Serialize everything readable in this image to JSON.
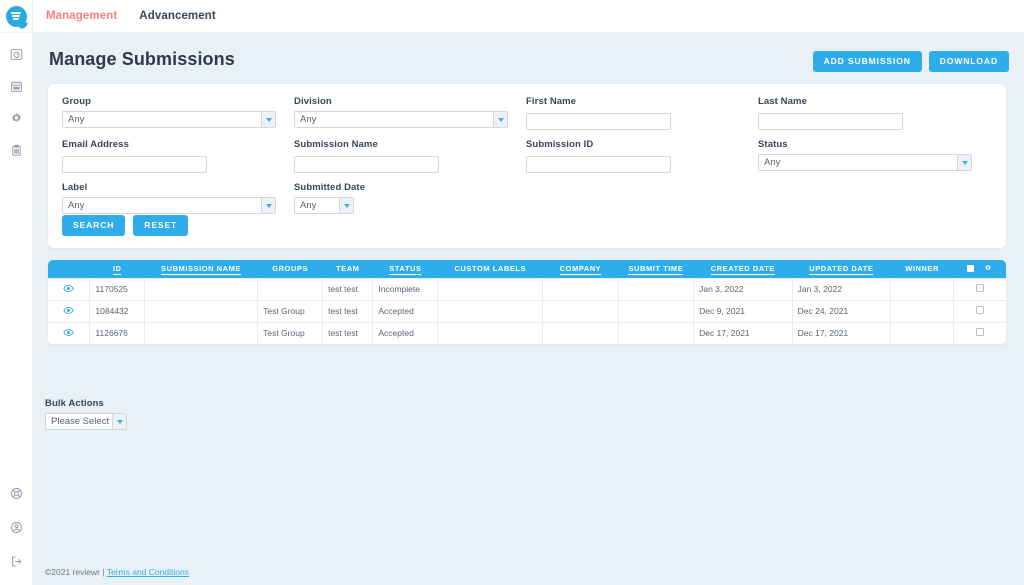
{
  "brand": {
    "logo_icon": "chat-bubble-logo",
    "accent": "#2fadea",
    "active_nav_color": "#f4837f"
  },
  "sidebar": {
    "top_items": [
      {
        "icon": "dashboard-gauge-icon",
        "name": "dashboard"
      },
      {
        "icon": "calendar-icon",
        "name": "calendar"
      },
      {
        "icon": "gear-icon",
        "name": "settings"
      },
      {
        "icon": "clipboard-icon",
        "name": "clipboard"
      }
    ],
    "bottom_items": [
      {
        "icon": "help-circle-icon",
        "name": "help"
      },
      {
        "icon": "user-circle-icon",
        "name": "account"
      },
      {
        "icon": "logout-icon",
        "name": "logout"
      }
    ]
  },
  "topnav": {
    "tabs": [
      {
        "label": "Management",
        "active": true
      },
      {
        "label": "Advancement",
        "active": false
      }
    ]
  },
  "header": {
    "title": "Manage Submissions",
    "add_submission_label": "ADD SUBMISSION",
    "download_label": "DOWNLOAD"
  },
  "filters": {
    "group": {
      "label": "Group",
      "value": "Any",
      "type": "select"
    },
    "division": {
      "label": "Division",
      "value": "Any",
      "type": "select"
    },
    "first_name": {
      "label": "First Name",
      "value": "",
      "placeholder": "",
      "type": "text"
    },
    "last_name": {
      "label": "Last Name",
      "value": "",
      "placeholder": "",
      "type": "text"
    },
    "email_address": {
      "label": "Email Address",
      "value": "",
      "placeholder": "",
      "type": "text"
    },
    "submission_name": {
      "label": "Submission Name",
      "value": "",
      "placeholder": "",
      "type": "text"
    },
    "submission_id": {
      "label": "Submission ID",
      "value": "",
      "placeholder": "",
      "type": "text"
    },
    "status": {
      "label": "Status",
      "value": "Any",
      "type": "select"
    },
    "label": {
      "label": "Label",
      "value": "Any",
      "type": "select"
    },
    "submitted_date": {
      "label": "Submitted Date",
      "value": "Any",
      "type": "select"
    },
    "search_label": "SEARCH",
    "reset_label": "RESET"
  },
  "table": {
    "columns": [
      {
        "key": "eye",
        "label": "",
        "sortable": false
      },
      {
        "key": "id",
        "label": "ID",
        "sortable": true
      },
      {
        "key": "name",
        "label": "SUBMISSION NAME",
        "sortable": true
      },
      {
        "key": "groups",
        "label": "GROUPS",
        "sortable": false
      },
      {
        "key": "team",
        "label": "TEAM",
        "sortable": false
      },
      {
        "key": "status",
        "label": "STATUS",
        "sortable": true
      },
      {
        "key": "labels",
        "label": "CUSTOM LABELS",
        "sortable": false
      },
      {
        "key": "company",
        "label": "COMPANY",
        "sortable": true
      },
      {
        "key": "submit_time",
        "label": "SUBMIT TIME",
        "sortable": true
      },
      {
        "key": "created",
        "label": "CREATED DATE",
        "sortable": true
      },
      {
        "key": "updated",
        "label": "UPDATED DATE",
        "sortable": true
      },
      {
        "key": "winner",
        "label": "WINNER",
        "sortable": false
      },
      {
        "key": "select",
        "label": "",
        "sortable": false
      }
    ],
    "header_icons": {
      "select_all": "checkbox-icon",
      "settings": "gear-icon"
    },
    "row_action_icon": "eye-icon",
    "rows": [
      {
        "id": "1170525",
        "name": "",
        "groups": "",
        "team": "test test",
        "status": "Incomplete",
        "labels": "",
        "company": "",
        "submit_time": "",
        "created": "Jan 3, 2022",
        "updated": "Jan 3, 2022",
        "winner": "",
        "selected": false
      },
      {
        "id": "1084432",
        "name": "",
        "groups": "Test Group",
        "team": "test test",
        "status": "Accepted",
        "labels": "",
        "company": "",
        "submit_time": "",
        "created": "Dec 9, 2021",
        "updated": "Dec 24, 2021",
        "winner": "",
        "selected": false
      },
      {
        "id": "1126676",
        "name": "",
        "groups": "Test Group",
        "team": "test test",
        "status": "Accepted",
        "labels": "",
        "company": "",
        "submit_time": "",
        "created": "Dec 17, 2021",
        "updated": "Dec 17, 2021",
        "winner": "",
        "selected": false
      }
    ]
  },
  "bulk_actions": {
    "label": "Bulk Actions",
    "value": "Please Select"
  },
  "footer": {
    "copyright": "©2021 reviewr | ",
    "terms_label": "Terms and Conditions"
  }
}
